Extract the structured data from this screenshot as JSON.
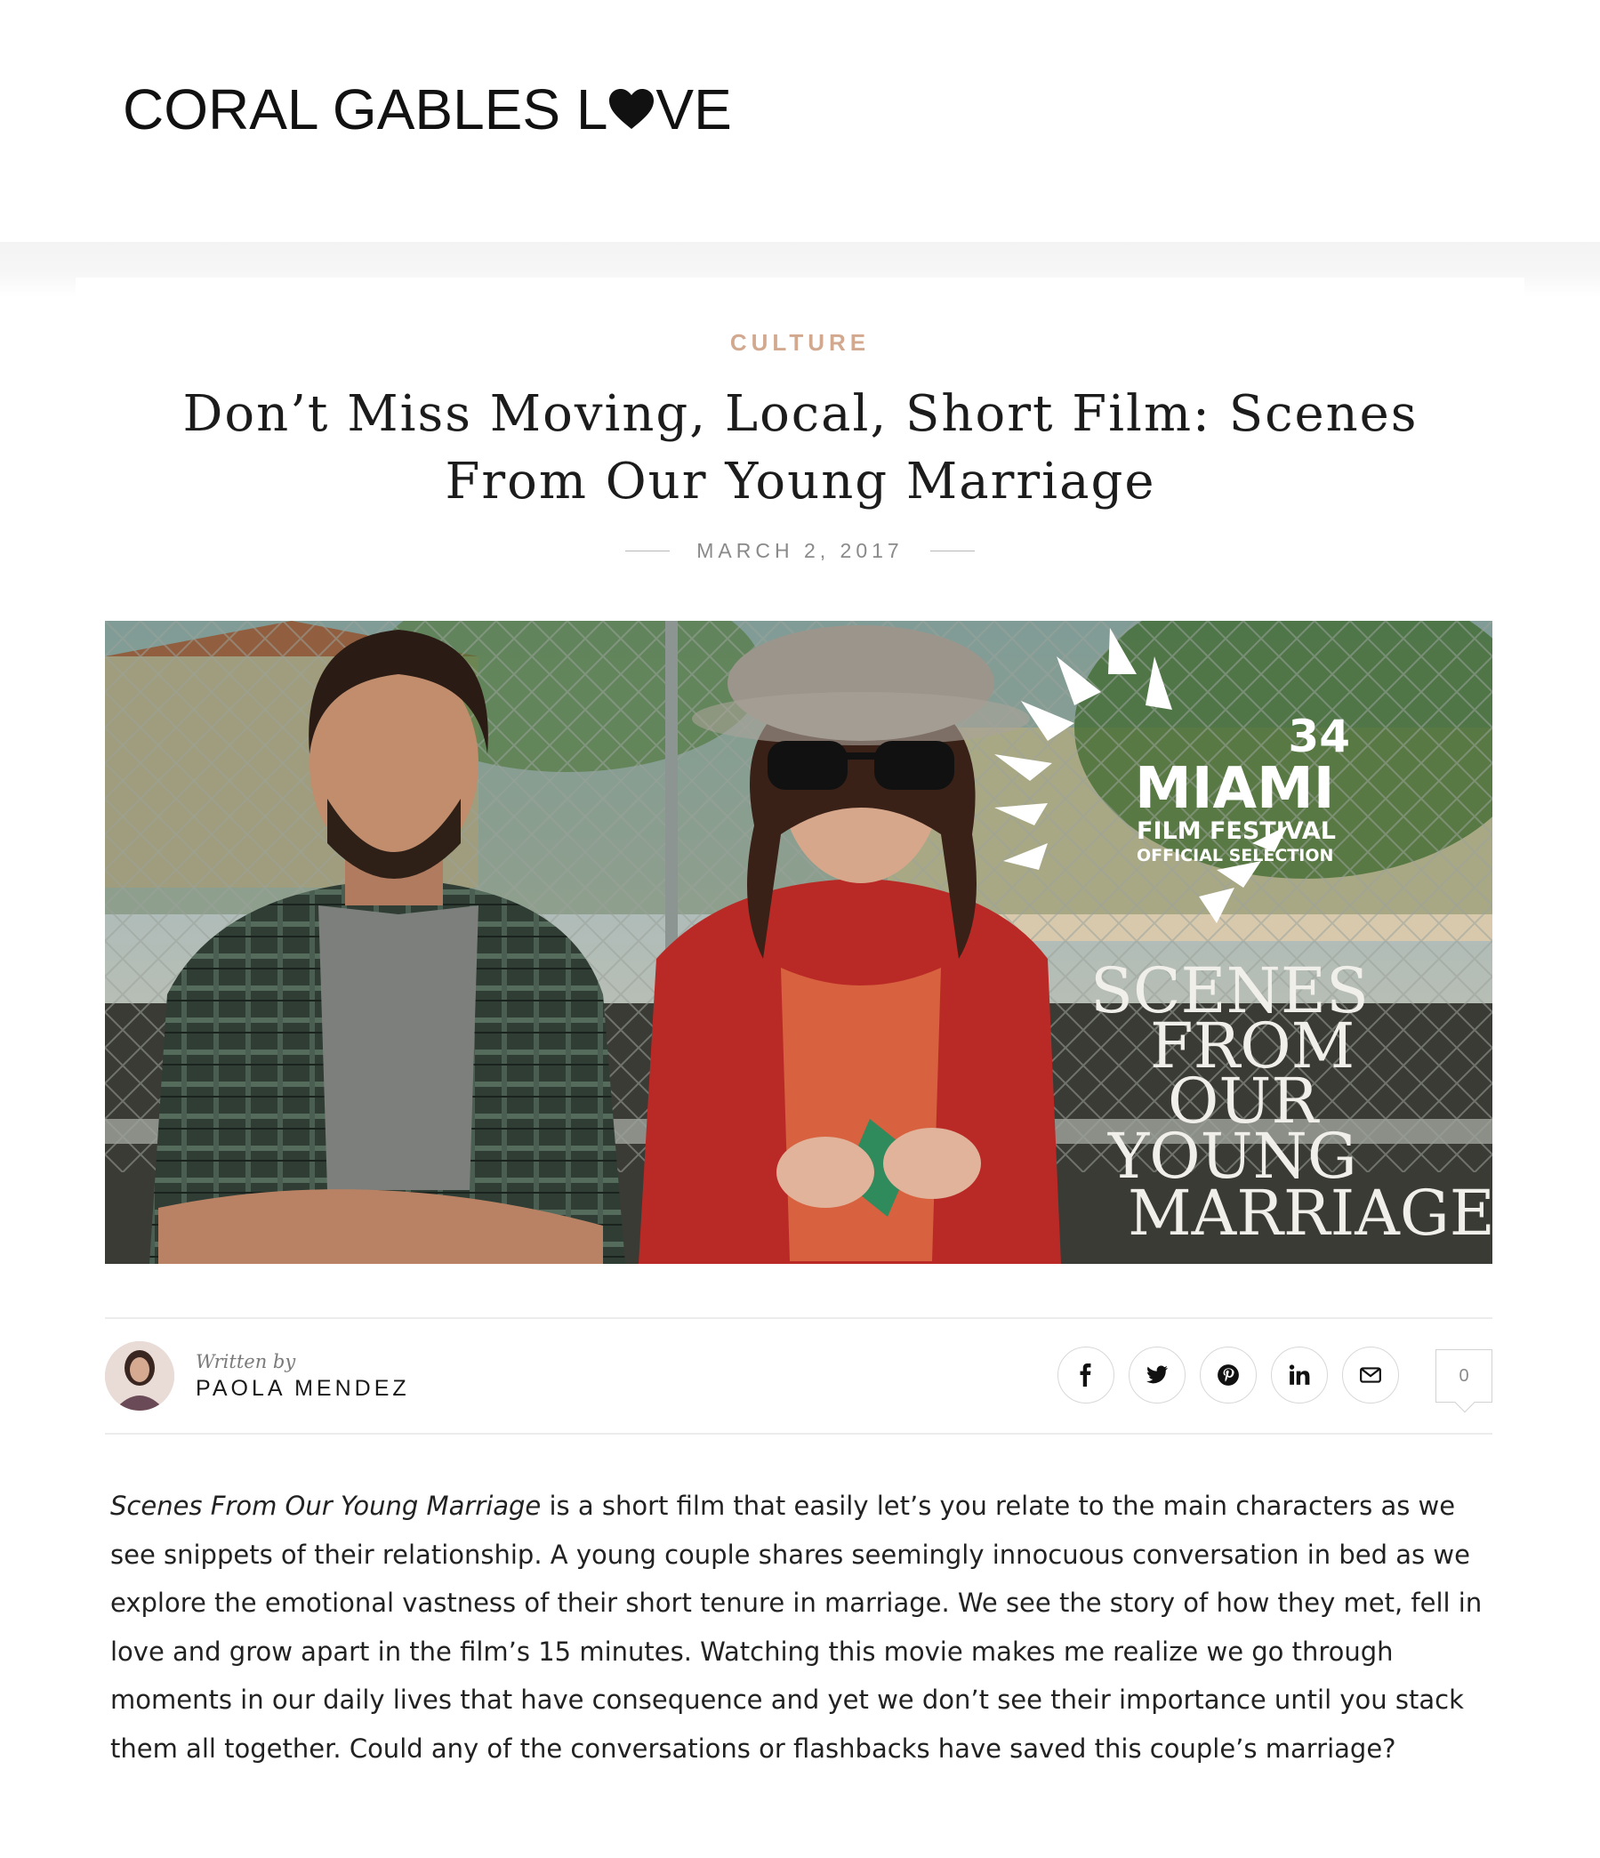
{
  "site": {
    "logo_left": "CORAL GABLES L",
    "logo_right": "VE"
  },
  "post": {
    "category": "CULTURE",
    "title": "Don’t Miss Moving, Local, Short Film: Scenes From Our Young Marriage",
    "date": "MARCH 2, 2017"
  },
  "hero": {
    "festival_number": "34",
    "festival_name": "MIAMI",
    "festival_subtitle": "FILM FESTIVAL",
    "festival_selection": "OFFICIAL SELECTION",
    "film_title_lines": [
      "SCENES",
      "FROM",
      "OUR",
      "YOUNG",
      "MARRIAGE"
    ]
  },
  "author": {
    "written_by": "Written by",
    "name": "PAOLA MENDEZ"
  },
  "share": {
    "icons": [
      "facebook-icon",
      "twitter-icon",
      "pinterest-icon",
      "linkedin-icon",
      "email-icon"
    ],
    "comment_count": "0"
  },
  "body": {
    "italic_title": "Scenes From Our Young Marriage",
    "paragraph_rest": " is a short film that easily let’s you relate to the main characters as we see snippets of their relationship. A young couple shares seemingly innocuous conversation in bed as we explore the emotional vastness of their short tenure in marriage. We see the story of how they met, fell in love and grow apart in the film’s 15 minutes. Watching this movie makes me realize we go through moments in our daily lives that have consequence and yet we don’t see their importance until you stack them all together. Could any of the conversations or flashbacks have saved this couple’s marriage?"
  },
  "colors": {
    "category": "#d2a98f",
    "text": "#1a1a1a",
    "muted": "#8a8a8a",
    "border": "#ececec"
  }
}
